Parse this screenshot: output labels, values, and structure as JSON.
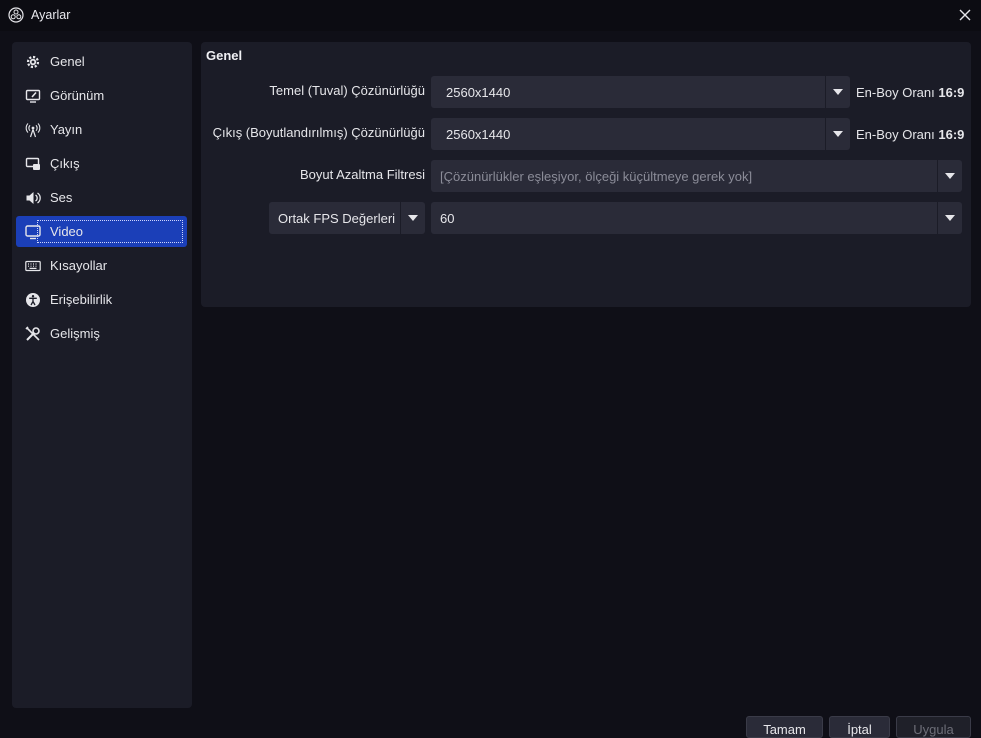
{
  "window": {
    "title": "Ayarlar"
  },
  "sidebar": {
    "items": [
      {
        "label": "Genel",
        "icon": "gear-icon"
      },
      {
        "label": "Görünüm",
        "icon": "appearance-icon"
      },
      {
        "label": "Yayın",
        "icon": "broadcast-icon"
      },
      {
        "label": "Çıkış",
        "icon": "output-icon"
      },
      {
        "label": "Ses",
        "icon": "speaker-icon"
      },
      {
        "label": "Video",
        "icon": "monitor-icon",
        "active": true
      },
      {
        "label": "Kısayollar",
        "icon": "keyboard-icon"
      },
      {
        "label": "Erişebilirlik",
        "icon": "accessibility-icon"
      },
      {
        "label": "Gelişmiş",
        "icon": "wrench-icon"
      }
    ]
  },
  "panel": {
    "title": "Genel",
    "base_resolution": {
      "label": "Temel (Tuval) Çözünürlüğü",
      "value": "2560x1440",
      "aspect_label": "En-Boy Oranı",
      "aspect_value": "16:9"
    },
    "output_resolution": {
      "label": "Çıkış (Boyutlandırılmış) Çözünürlüğü",
      "value": "2560x1440",
      "aspect_label": "En-Boy Oranı",
      "aspect_value": "16:9"
    },
    "downscale_filter": {
      "label": "Boyut Azaltma Filtresi",
      "value": "[Çözünürlükler eşleşiyor, ölçeği küçültmeye gerek yok]"
    },
    "fps": {
      "type_label": "Ortak FPS Değerleri",
      "value": "60"
    }
  },
  "buttons": {
    "ok": "Tamam",
    "cancel": "İptal",
    "apply": "Uygula"
  },
  "colors": {
    "accent": "#1b3fb8",
    "panel": "#1b1c27",
    "background": "#0f0f17",
    "control": "#2a2b38"
  }
}
